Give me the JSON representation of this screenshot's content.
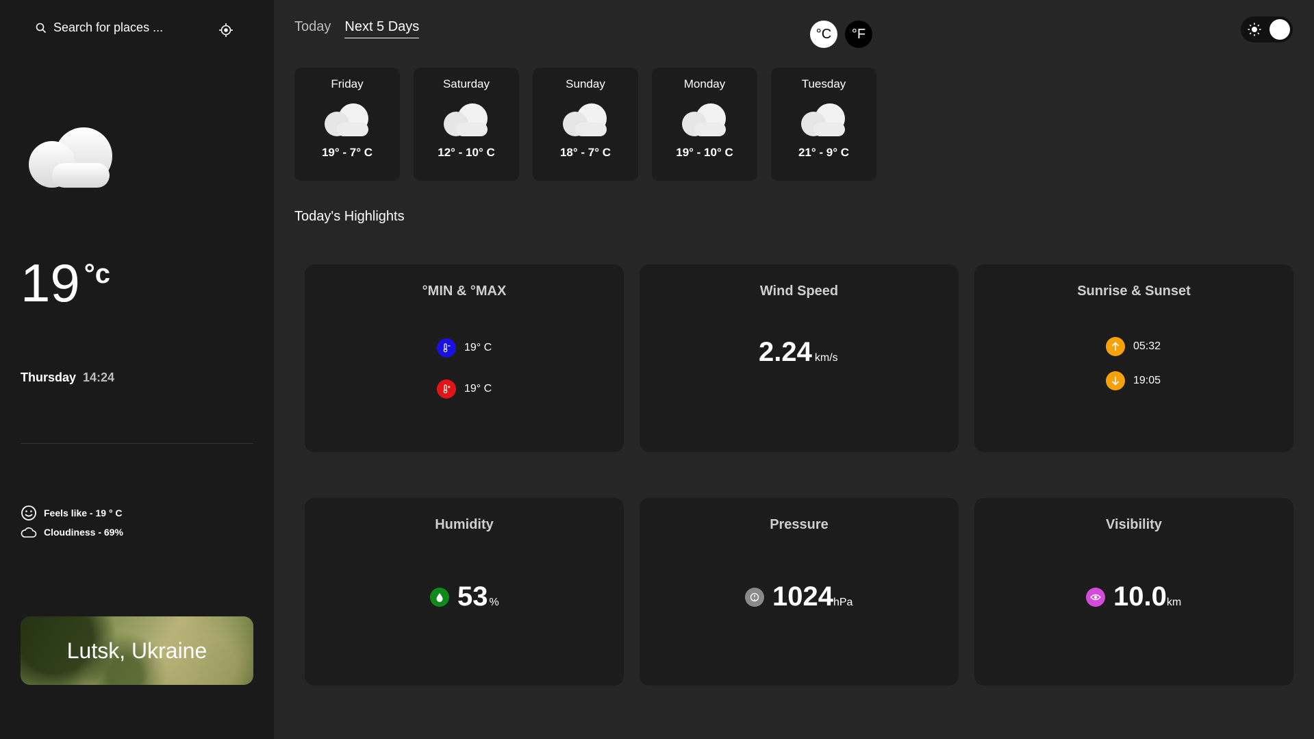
{
  "search": {
    "placeholder": "Search for places ..."
  },
  "current": {
    "temp": "19",
    "unit": "°c",
    "day": "Thursday",
    "time": "14:24",
    "feels_like": "Feels like - 19 ° C",
    "cloudiness": "Cloudiness - 69%",
    "location": "Lutsk, Ukraine"
  },
  "tabs": [
    {
      "label": "Today"
    },
    {
      "label": "Next 5 Days"
    }
  ],
  "units": {
    "c": "°C",
    "f": "°F"
  },
  "forecast": [
    {
      "day": "Friday",
      "range": "19° - 7° C"
    },
    {
      "day": "Saturday",
      "range": "12° - 10° C"
    },
    {
      "day": "Sunday",
      "range": "18° - 7° C"
    },
    {
      "day": "Monday",
      "range": "19° - 10° C"
    },
    {
      "day": "Tuesday",
      "range": "21° - 9° C"
    }
  ],
  "highlights_title": "Today's Highlights",
  "highlights": {
    "minmax": {
      "title": "°MIN & °MAX",
      "min": "19° C",
      "max": "19° C"
    },
    "wind": {
      "title": "Wind Speed",
      "value": "2.24",
      "unit": "km/s"
    },
    "sun": {
      "title": "Sunrise & Sunset",
      "sunrise": "05:32",
      "sunset": "19:05"
    },
    "humidity": {
      "title": "Humidity",
      "value": "53",
      "unit": "%"
    },
    "pressure": {
      "title": "Pressure",
      "value": "1024",
      "unit": "hPa"
    },
    "visibility": {
      "title": "Visibility",
      "value": "10.0",
      "unit": "km"
    }
  },
  "colors": {
    "bg": "#262626",
    "sidebar": "#1a1a1a",
    "card": "#1c1c1c",
    "min_badge": "#1a10e0",
    "max_badge": "#e01515",
    "sun_badge": "#f5a10a",
    "humidity_badge": "#0f8a1a",
    "pressure_badge": "#8a8a8a",
    "visibility_badge": "#d54bd9"
  }
}
